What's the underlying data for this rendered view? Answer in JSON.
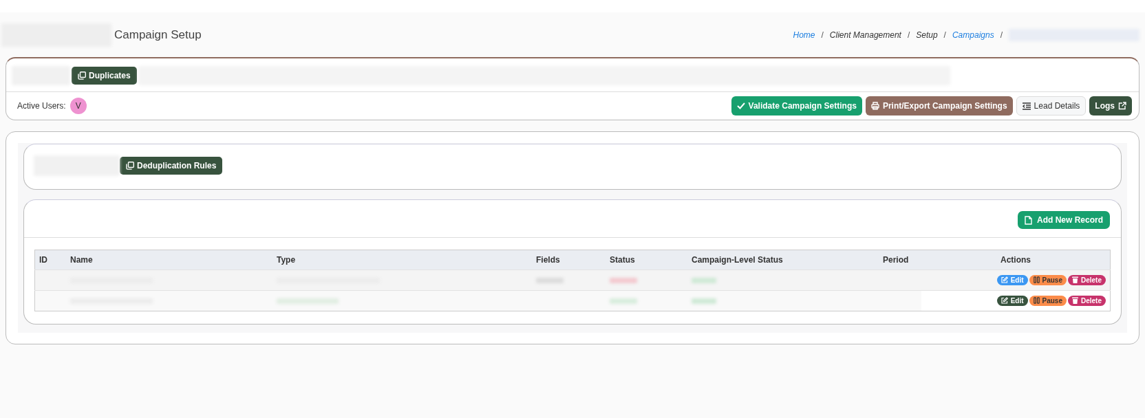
{
  "page_title": "Campaign Setup",
  "breadcrumb": [
    {
      "label": "Home",
      "link": true,
      "separator": "/"
    },
    {
      "label": "Client Management",
      "link": false,
      "separator": "/"
    },
    {
      "label": "Setup",
      "link": false,
      "separator": "/"
    },
    {
      "label": "Campaigns",
      "link": true,
      "separator": "/"
    }
  ],
  "top_tabs": [
    {
      "label": "Duplicates",
      "selected": true
    }
  ],
  "active_users": {
    "label": "Active Users:",
    "users": [
      {
        "initial": "V",
        "color": "#ee92d0"
      }
    ]
  },
  "actions": [
    {
      "kind": "validate",
      "label": "Validate Campaign Settings"
    },
    {
      "kind": "print",
      "label": "Print/Export Campaign Settings"
    },
    {
      "kind": "details",
      "label": "Lead Details"
    },
    {
      "kind": "logs",
      "label": "Logs"
    }
  ],
  "sub_tabs": [
    {
      "label": "Deduplication Rules",
      "selected": true
    }
  ],
  "add_button": "Add New Record",
  "table": {
    "columns": [
      "ID",
      "Name",
      "Type",
      "Fields",
      "Status",
      "Campaign-Level Status",
      "Period",
      "Actions"
    ],
    "rows": [
      {
        "edit": {
          "label": "Edit",
          "color": "#3b97f2"
        },
        "pause": "Pause",
        "delete": "Delete"
      },
      {
        "edit": {
          "label": "Edit",
          "color": "#38533e"
        },
        "pause": "Pause",
        "delete": "Delete"
      }
    ]
  }
}
